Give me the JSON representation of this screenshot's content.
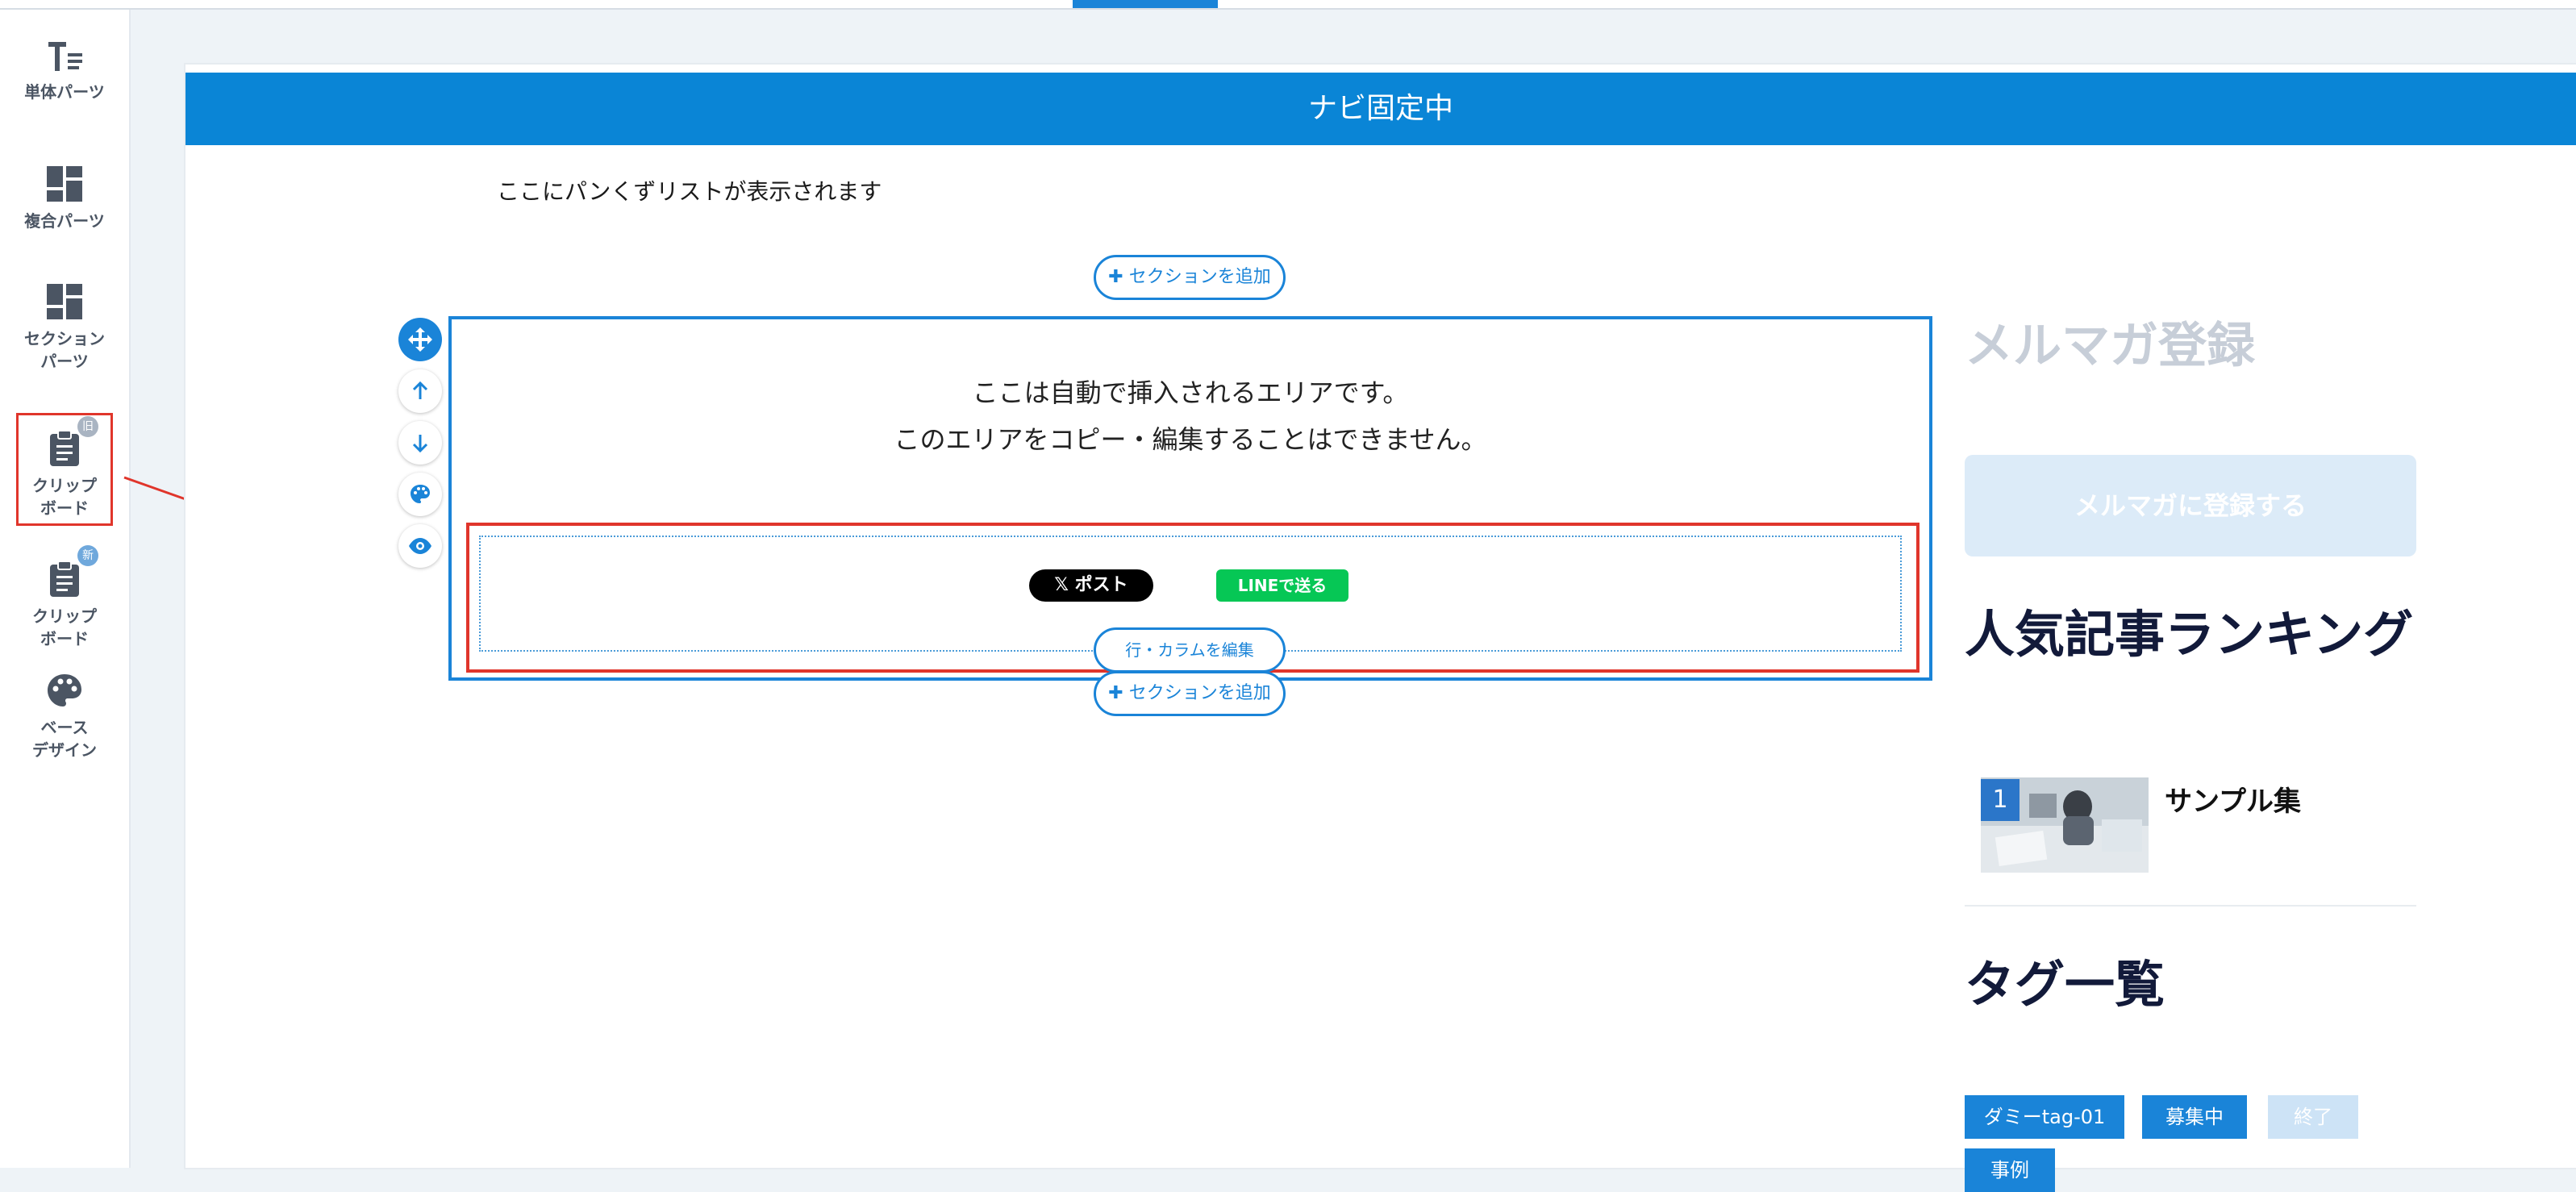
{
  "toolbar": {
    "items": [
      {
        "label": "単体パーツ",
        "icon": "text-parts-icon"
      },
      {
        "label": "複合パーツ",
        "icon": "grid-parts-icon"
      },
      {
        "label": "セクション\nパーツ",
        "icon": "section-parts-icon"
      },
      {
        "label": "クリップ\nボード",
        "icon": "clipboard-icon",
        "badge": "旧"
      },
      {
        "label": "クリップ\nボード",
        "icon": "clipboard-icon",
        "badge": "新"
      },
      {
        "label": "ベース\nデザイン",
        "icon": "palette-icon"
      }
    ]
  },
  "nav": {
    "title": "ナビ固定中"
  },
  "breadcrumb": {
    "text": "ここにパンくずリストが表示されます"
  },
  "editor": {
    "add_section_label": "✚ セクションを追加",
    "auto_area_line1": "ここは自動で挿入されるエリアです。",
    "auto_area_line2": "このエリアをコピー・編集することはできません。",
    "edit_row_label": "行・カラムを編集",
    "x_post_label": "𝕏 ポスト",
    "line_send_label": "LINEで送る"
  },
  "sidebar": {
    "newsletter_title": "メルマガ登録",
    "newsletter_button": "メルマガに登録する",
    "ranking_title": "人気記事ランキング",
    "ranking": [
      {
        "rank": "1",
        "title": "サンプル集"
      }
    ],
    "tags_title": "タグ一覧",
    "tags": [
      "ダミーtag-01",
      "募集中",
      "終了",
      "事例"
    ]
  },
  "colors": {
    "accent": "#1a84d8",
    "highlight": "#e0352b",
    "line_green": "#06c755"
  }
}
